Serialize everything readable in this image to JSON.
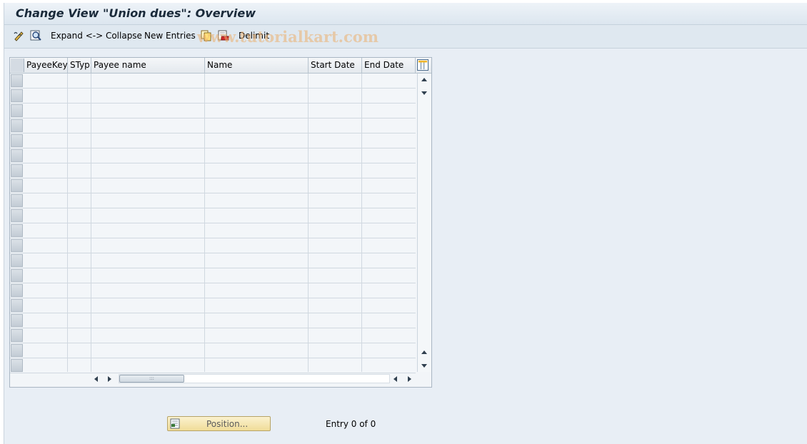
{
  "window": {
    "title": "Change View \"Union dues\": Overview"
  },
  "toolbar": {
    "expand_collapse_label": "Expand <-> Collapse",
    "new_entries_label": "New Entries",
    "delimit_label": "Delimit",
    "icons": [
      "display-change-icon",
      "find-icon",
      "copy-icon",
      "delete-icon"
    ]
  },
  "watermark": "www.tutorialkart.com",
  "table": {
    "columns": [
      "PayeeKey",
      "STyp",
      "Payee name",
      "Name",
      "Start Date",
      "End Date"
    ],
    "rows": [],
    "visible_row_count": 20
  },
  "footer": {
    "position_button_label": "Position...",
    "entry_status": "Entry 0 of 0"
  },
  "colors": {
    "background": "#e8eef5",
    "position_button": "#f0dc98"
  }
}
